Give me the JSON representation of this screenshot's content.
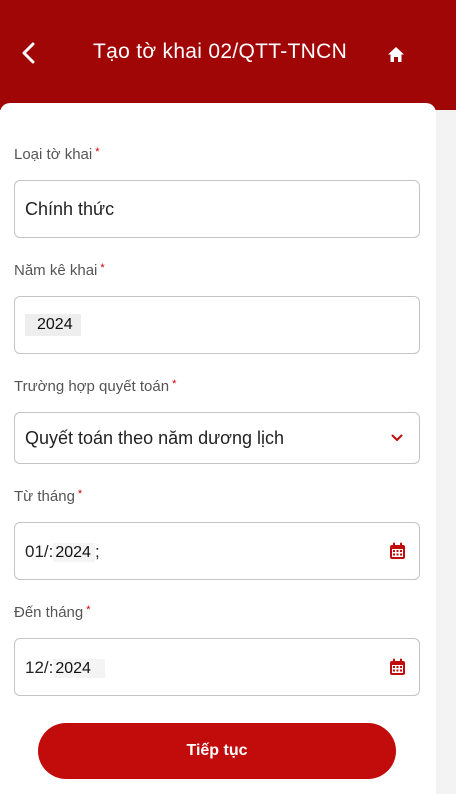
{
  "header": {
    "title": "Tạo tờ khai 02/QTT-TNCN",
    "back_icon": "chevron-left-icon",
    "home_icon": "home-icon"
  },
  "form": {
    "required_mark": "*",
    "declaration_type": {
      "label": "Loại tờ khai",
      "value": "Chính thức"
    },
    "declaration_year": {
      "label": "Năm kê khai",
      "value": "2024"
    },
    "settlement_case": {
      "label": "Trường hợp quyết toán",
      "value": "Quyết toán theo năm dương lịch",
      "icon": "chevron-down-icon"
    },
    "from_month": {
      "label": "Từ tháng",
      "month_prefix": "01/:",
      "year": "2024",
      "suffix": ";",
      "icon": "calendar-icon"
    },
    "to_month": {
      "label": "Đến tháng",
      "month_prefix": "12/:",
      "year": "2024",
      "icon": "calendar-icon"
    }
  },
  "actions": {
    "continue_label": "Tiếp tục"
  },
  "colors": {
    "brand_red": "#a00606",
    "button_red": "#c20b0b"
  }
}
